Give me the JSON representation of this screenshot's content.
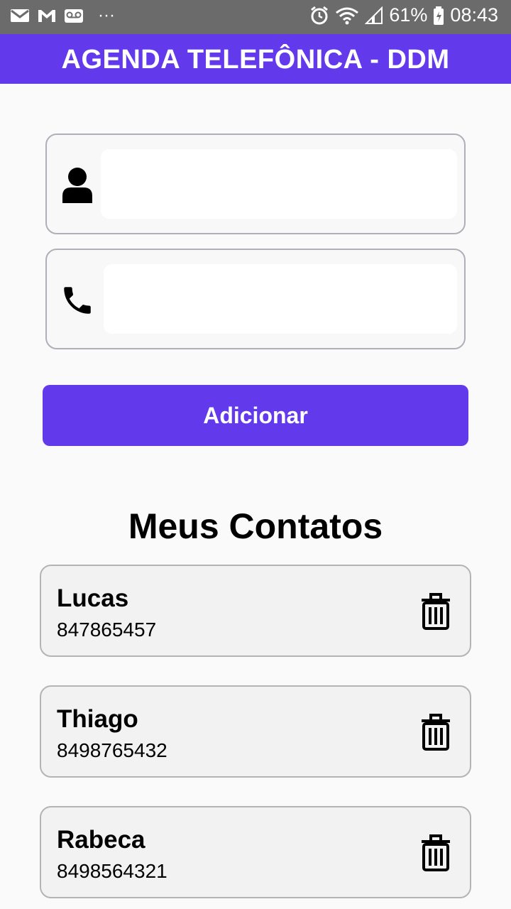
{
  "status_bar": {
    "battery": "61%",
    "time": "08:43",
    "more": "···"
  },
  "app_bar": {
    "title": "AGENDA TELEFÔNICA - DDM"
  },
  "form": {
    "name_field": {
      "value": "",
      "icon": "person-icon"
    },
    "phone_field": {
      "value": "",
      "icon": "phone-icon"
    },
    "add_button_label": "Adicionar"
  },
  "contacts_section": {
    "title": "Meus Contatos",
    "contacts": [
      {
        "name": "Lucas",
        "phone": "847865457"
      },
      {
        "name": "Thiago",
        "phone": "8498765432"
      },
      {
        "name": "Rabeca",
        "phone": "8498564321"
      }
    ]
  },
  "colors": {
    "accent": "#6339ec",
    "status_bar": "#6b6b6b"
  }
}
